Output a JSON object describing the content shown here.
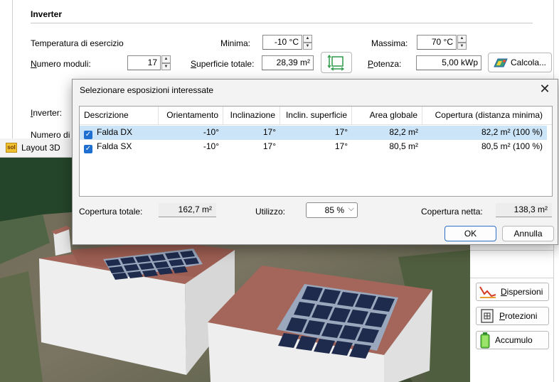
{
  "inverter_section": {
    "title": "Inverter",
    "temp_label": "Temperatura di esercizio",
    "min_label": "Minima:",
    "min_value": "-10 °C",
    "max_label": "Massima:",
    "max_value": "70 °C",
    "modules_label": "Numero moduli:",
    "modules_value": "17",
    "surface_label": "Superficie totale:",
    "surface_value": "28,39 m²",
    "power_label": "Potenza:",
    "power_value": "5,00 kWp",
    "calc_label": "Calcola...",
    "inverter_label": "Inverter:",
    "modules_cut_label": "Numero di"
  },
  "layout3d": {
    "title": "Layout 3D",
    "icon_text": "sol"
  },
  "dialog": {
    "title": "Selezionare esposizioni interessate",
    "columns": [
      "Descrizione",
      "Orientamento",
      "Inclinazione",
      "Inclin. superficie",
      "Area globale",
      "Copertura (distanza minima)"
    ],
    "rows": [
      {
        "name": "Falda DX",
        "orientation": "-10°",
        "inclination": "17°",
        "surface_incl": "17°",
        "area": "82,2 m²",
        "coverage": "82,2 m² (100 %)"
      },
      {
        "name": "Falda SX",
        "orientation": "-10°",
        "inclination": "17°",
        "surface_incl": "17°",
        "area": "80,5 m²",
        "coverage": "80,5 m² (100 %)"
      }
    ],
    "total_coverage_label": "Copertura totale:",
    "total_coverage_value": "162,7 m²",
    "usage_label": "Utilizzo:",
    "usage_value": "85 %",
    "net_coverage_label": "Copertura netta:",
    "net_coverage_value": "138,3 m²",
    "ok_label": "OK",
    "cancel_label": "Annulla"
  },
  "side_buttons": {
    "dispersioni": "Dispersioni",
    "protezioni": "Protezioni",
    "accumulo": "Accumulo"
  },
  "colors": {
    "accent": "#1f6fd1",
    "selected_row": "#cce4f7",
    "roof": "#a4665a"
  }
}
